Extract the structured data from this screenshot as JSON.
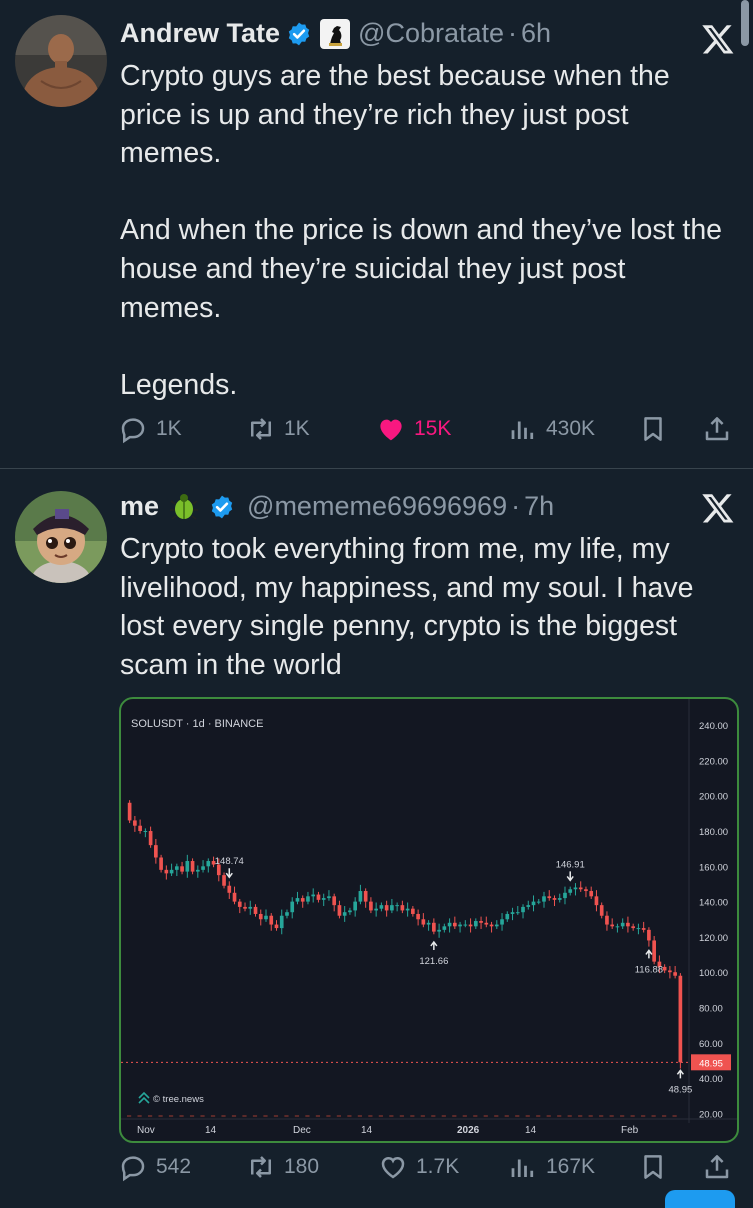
{
  "tweet1": {
    "name": "Andrew Tate",
    "handle": "@Cobratate",
    "sep": "·",
    "time": "6h",
    "text": "Crypto guys are the best because when the price is up and they’re rich they just post memes.\n\nAnd when the price is down and they’ve lost the house and they’re suicidal they just post memes.\n\nLegends.",
    "replies": "1K",
    "reposts": "1K",
    "likes": "15K",
    "views": "430K",
    "like_color": "#f91880",
    "liked": true
  },
  "tweet2": {
    "name": "me",
    "handle": "@mememe69696969",
    "sep": "·",
    "time": "7h",
    "text": "Crypto took everything from me, my life, my livelihood, my happiness, and my soul. I have lost every single penny, crypto is the biggest scam in the world",
    "replies": "542",
    "reposts": "180",
    "likes": "1.7K",
    "views": "167K"
  },
  "icons": {
    "verified": "verified-badge-icon",
    "x": "x-logo-icon",
    "reply": "reply-icon",
    "repost": "repost-icon",
    "like": "heart-icon",
    "views": "views-icon",
    "bookmark": "bookmark-icon",
    "share": "share-icon"
  },
  "colors": {
    "background": "#15202b",
    "accent": "#1d9bf0",
    "chart_up": "#26a69a",
    "chart_down": "#ef5350",
    "chart_border": "#3d8b3d"
  },
  "chart_data": {
    "type": "candlestick",
    "title": "SOLUSDT · 1d · BINANCE",
    "watermark": "© tree.news",
    "x_labels": [
      "Nov",
      "14",
      "Dec",
      "14",
      "2026",
      "14",
      "Feb"
    ],
    "y_ticks": [
      240,
      220,
      200,
      180,
      160,
      140,
      120,
      100,
      80,
      60,
      40,
      20
    ],
    "ylim": [
      14,
      248
    ],
    "last_price": 48.95,
    "annotations": [
      {
        "label": "146.91",
        "value": 146.91,
        "kind": "high"
      },
      {
        "label": "121.66",
        "value": 121.66,
        "kind": "low"
      },
      {
        "label": "116.88",
        "value": 116.88,
        "kind": "low"
      },
      {
        "label": "148.74",
        "value": 148.74,
        "kind": "high"
      },
      {
        "label": "48.95",
        "value": 48.95,
        "kind": "low"
      }
    ],
    "close": [
      186,
      183,
      180,
      180,
      172,
      165,
      158,
      156,
      158,
      160,
      157,
      163,
      157,
      158,
      160,
      163,
      161,
      155,
      149,
      145,
      140,
      137,
      136,
      137,
      133,
      130,
      132,
      127,
      125,
      132,
      134,
      140,
      142,
      140,
      143,
      144,
      141,
      142,
      143,
      138,
      132,
      134,
      135,
      140,
      146,
      140,
      135,
      136,
      138,
      135,
      138,
      138,
      135,
      136,
      133,
      130,
      127,
      128,
      123,
      124,
      126,
      128,
      126,
      127,
      127,
      126,
      129,
      128,
      127,
      126,
      127,
      130,
      133,
      134,
      134,
      137,
      138,
      140,
      140,
      143,
      142,
      141,
      142,
      145,
      147,
      148,
      147,
      146,
      143,
      138,
      132,
      127,
      126,
      126,
      128,
      126,
      125,
      125,
      124,
      118,
      106,
      103,
      101,
      100,
      98,
      48.95
    ]
  }
}
